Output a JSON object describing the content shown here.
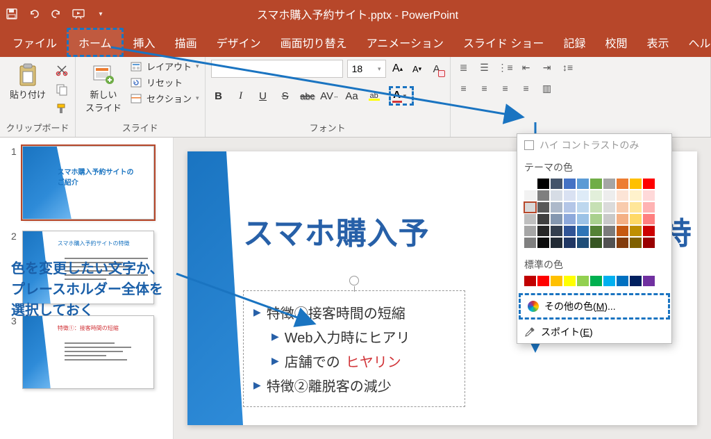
{
  "title": "スマホ購入予約サイト.pptx - PowerPoint",
  "tabs": {
    "file": "ファイル",
    "home": "ホーム",
    "insert": "挿入",
    "draw": "描画",
    "design": "デザイン",
    "transitions": "画面切り替え",
    "animations": "アニメーション",
    "slideshow": "スライド ショー",
    "record": "記録",
    "review": "校閲",
    "view": "表示",
    "help": "ヘルプ"
  },
  "ribbon": {
    "clipboard": {
      "label": "クリップボード",
      "paste": "貼り付け"
    },
    "slides": {
      "label": "スライド",
      "new_slide": "新しい\nスライド",
      "layout": "レイアウト",
      "reset": "リセット",
      "section": "セクション"
    },
    "font": {
      "label": "フォント",
      "size": "18",
      "inc": "A",
      "dec": "A",
      "bold": "B",
      "italic": "I",
      "underline": "U",
      "strike": "S",
      "shadow": "abc",
      "spacing": "AV",
      "case": "Aa"
    }
  },
  "callout": "色を変更したい文字か、\nプレースホルダー全体を\n選択しておく",
  "thumbs": {
    "t1": {
      "num": "1",
      "title": "スマホ購入予約サイトの\nご紹介"
    },
    "t2": {
      "num": "2",
      "title": "スマホ購入予約サイトの特徴"
    },
    "t3": {
      "num": "3",
      "title": "特徴①：接客時間の短縮"
    }
  },
  "slide": {
    "title_left": "スマホ購入予",
    "title_right": "特",
    "l1": "特徴①接客時間の短縮",
    "l2a": "Web入力時にヒアリ",
    "l3a": "店舗での",
    "l3b": "ヒヤリン",
    "l4": "特徴②離脱客の減少"
  },
  "dropdown": {
    "high_contrast": "ハイ コントラストのみ",
    "theme_colors": "テーマの色",
    "standard_colors": "標準の色",
    "more_pre": "その他の色(",
    "more_key": "M",
    "more_post": ")...",
    "eyedropper_pre": "スポイト(",
    "eyedropper_key": "E",
    "eyedropper_post": ")"
  },
  "colors": {
    "theme_row1": [
      "#ffffff",
      "#000000",
      "#44546a",
      "#4472c4",
      "#5b9bd5",
      "#70ad47",
      "#a5a5a5",
      "#ed7d31",
      "#ffc000",
      "#ff0000"
    ],
    "shade_rows": [
      [
        "#f2f2f2",
        "#7f7f7f",
        "#d6dce5",
        "#d9e1f2",
        "#deebf7",
        "#e2efda",
        "#ededed",
        "#fce4d6",
        "#fff2cc",
        "#ffd9d9"
      ],
      [
        "#d9d9d9",
        "#595959",
        "#adb9ca",
        "#b4c6e7",
        "#bdd7ee",
        "#c6e0b4",
        "#dbdbdb",
        "#f8cbad",
        "#ffe699",
        "#ffb3b3"
      ],
      [
        "#bfbfbf",
        "#404040",
        "#8497b0",
        "#8ea9db",
        "#9bc2e6",
        "#a9d08e",
        "#c9c9c9",
        "#f4b084",
        "#ffd966",
        "#ff8080"
      ],
      [
        "#a6a6a6",
        "#262626",
        "#333f4f",
        "#305496",
        "#2e75b6",
        "#548235",
        "#7b7b7b",
        "#c65911",
        "#bf8f00",
        "#cc0000"
      ],
      [
        "#808080",
        "#0d0d0d",
        "#222b35",
        "#203764",
        "#1f4e78",
        "#375623",
        "#525252",
        "#833c0c",
        "#806000",
        "#990000"
      ]
    ],
    "standard": [
      "#c00000",
      "#ff0000",
      "#ffc000",
      "#ffff00",
      "#92d050",
      "#00b050",
      "#00b0f0",
      "#0070c0",
      "#002060",
      "#7030a0"
    ]
  }
}
